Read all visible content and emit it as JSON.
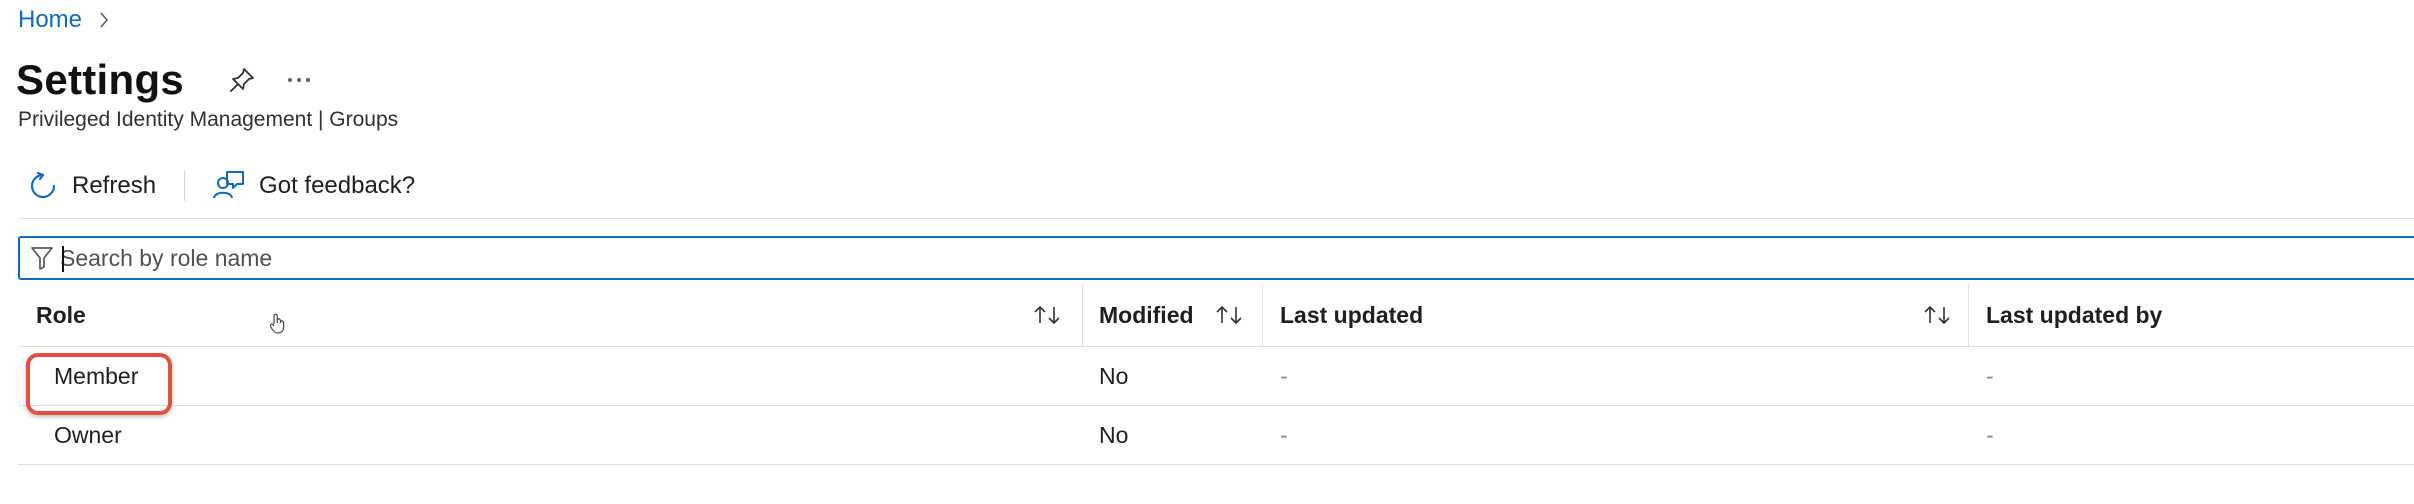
{
  "breadcrumb": {
    "home": "Home"
  },
  "header": {
    "title": "Settings",
    "subtitle": "Privileged Identity Management | Groups",
    "icons": [
      "pin-icon",
      "more-icon"
    ]
  },
  "toolbar": {
    "refresh_label": "Refresh",
    "feedback_label": "Got feedback?"
  },
  "search": {
    "placeholder": "Search by role name",
    "value": ""
  },
  "table": {
    "columns": [
      "Role",
      "Modified",
      "Last updated",
      "Last updated by"
    ],
    "rows": [
      {
        "role": "Member",
        "modified": "No",
        "last_updated": "-",
        "last_updated_by": "-"
      },
      {
        "role": "Owner",
        "modified": "No",
        "last_updated": "-",
        "last_updated_by": "-"
      }
    ]
  },
  "colors": {
    "accent": "#0f6cbd",
    "highlight": "#e0523f"
  }
}
